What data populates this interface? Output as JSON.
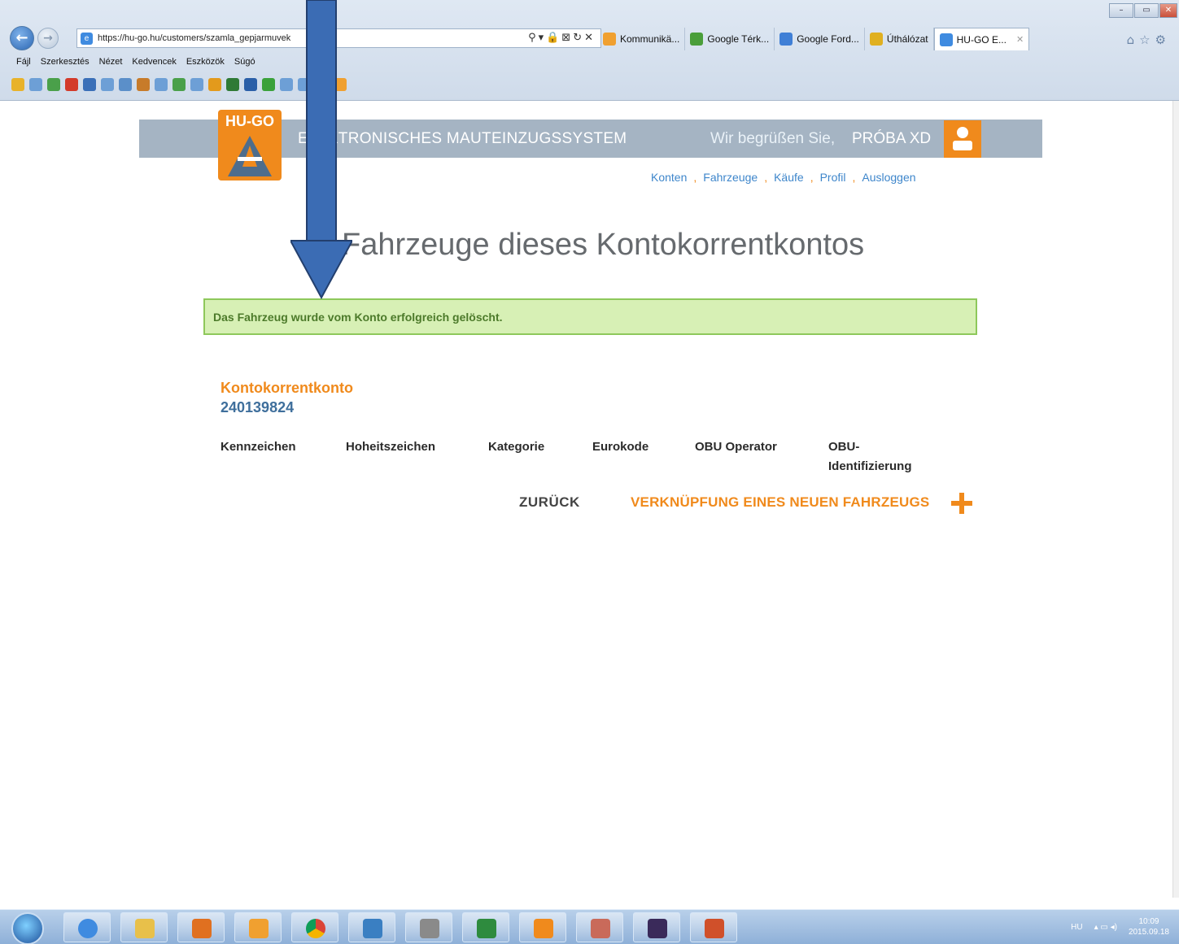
{
  "browser": {
    "url": "https://hu-go.hu/customers/szamla_gepjarmuvek",
    "tabs": [
      {
        "label": "Kommunikä...",
        "color": "#f0a030"
      },
      {
        "label": "Google Térk...",
        "color": "#4a9e3a"
      },
      {
        "label": "Google Ford...",
        "color": "#3f7fd6"
      },
      {
        "label": "Úthálózat",
        "color": "#e0b020"
      },
      {
        "label": "HU-GO E...",
        "color": "#3f8be0",
        "active": true
      }
    ],
    "menu": [
      "Fájl",
      "Szerkesztés",
      "Nézet",
      "Kedvencek",
      "Eszközök",
      "Súgó"
    ]
  },
  "header": {
    "logo_text": "HU-GO",
    "system_title": "ELEKTRONISCHES MAUTEINZUGSSYSTEM",
    "welcome": "Wir begrüßen Sie,",
    "username": "PRÓBA XD"
  },
  "nav": {
    "items": [
      "Konten",
      "Fahrzeuge",
      "Käufe",
      "Profil",
      "Ausloggen"
    ]
  },
  "page": {
    "title": "Fahrzeuge dieses Kontokorrentkontos",
    "success_message": "Das Fahrzeug wurde vom Konto erfolgreich gelöscht.",
    "account_label": "Kontokorrentkonto",
    "account_number": "240139824",
    "columns": [
      "Kennzeichen",
      "Hoheitszeichen",
      "Kategorie",
      "Eurokode",
      "OBU Operator",
      "OBU-",
      "Identifizierung"
    ],
    "back_label": "ZURÜCK",
    "add_vehicle_label": "VERKNÜPFUNG EINES NEUEN FAHRZEUGS"
  },
  "colors": {
    "brand_orange": "#f08a1c",
    "header_band": "#a5b4c3",
    "success_bg": "#d7f0b5",
    "success_border": "#8ec85b",
    "link_blue": "#3e86cb",
    "arrow_blue": "#3b6cb4"
  },
  "taskbar": {
    "time": "10:09",
    "date": "2015.09.18",
    "lang": "HU"
  }
}
